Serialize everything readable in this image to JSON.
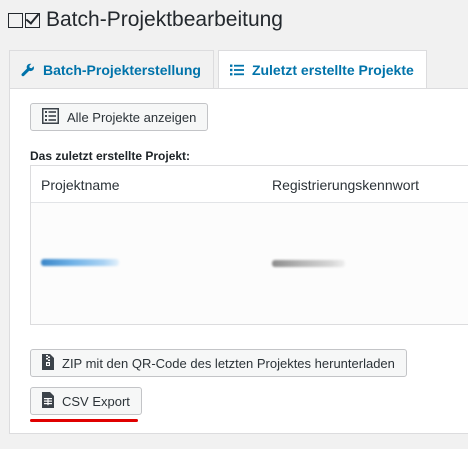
{
  "page": {
    "title": "Batch-Projektbearbeitung"
  },
  "tabs": [
    {
      "label": "Batch-Projekterstellung",
      "icon": "wrench-icon",
      "active": false
    },
    {
      "label": "Zuletzt erstellte Projekte",
      "icon": "list-icon",
      "active": true
    }
  ],
  "panel": {
    "show_all_button": "Alle Projekte anzeigen",
    "section_label": "Das zuletzt erstellte Projekt:",
    "table": {
      "headers": [
        "Projektname",
        "Registrierungskennwort"
      ]
    },
    "zip_button": "ZIP mit den QR-Code des letzten Projektes herunterladen",
    "csv_button": "CSV Export"
  },
  "colors": {
    "link": "#0073aa",
    "highlight": "#e00000"
  }
}
